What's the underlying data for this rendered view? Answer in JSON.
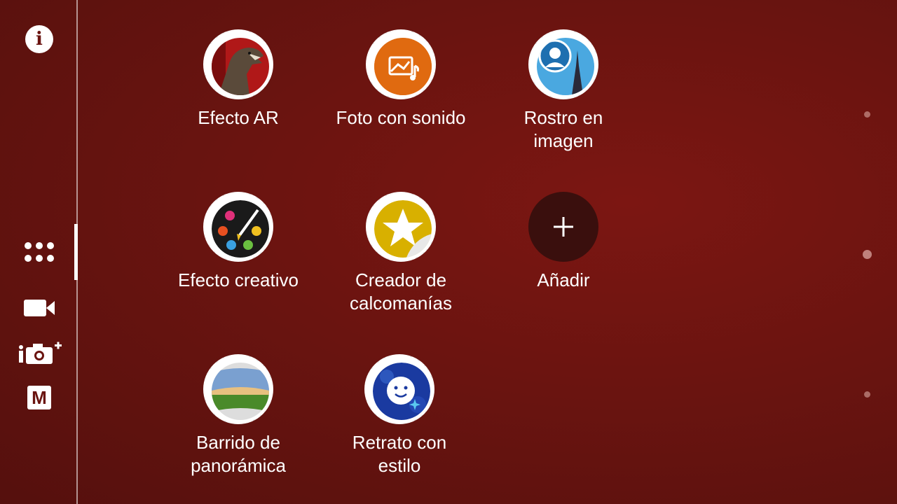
{
  "sidebar": {
    "icons": [
      {
        "name": "info-icon",
        "glyph": "i"
      },
      {
        "name": "apps-grid-icon"
      },
      {
        "name": "video-camera-icon"
      },
      {
        "name": "superior-auto-icon"
      },
      {
        "name": "manual-mode-icon",
        "glyph": "M"
      }
    ]
  },
  "apps": [
    {
      "label": "Efecto AR",
      "icon": "dinosaur-icon"
    },
    {
      "label": "Foto con sonido",
      "icon": "photo-sound-icon"
    },
    {
      "label": "Rostro en\nimagen",
      "icon": "face-in-picture-icon"
    },
    {
      "label": "Efecto creativo",
      "icon": "palette-icon"
    },
    {
      "label": "Creador de\ncalcomanías",
      "icon": "sticker-star-icon"
    },
    {
      "label": "Añadir",
      "icon": "plus-icon"
    },
    {
      "label": "Barrido de\npanorámica",
      "icon": "panorama-icon"
    },
    {
      "label": "Retrato con\nestilo",
      "icon": "style-portrait-icon"
    }
  ],
  "colors": {
    "background": "#6a1410",
    "add_button": "#3a0f0d",
    "photo_sound": "#e06a10",
    "face_sky": "#4aa8e0"
  }
}
